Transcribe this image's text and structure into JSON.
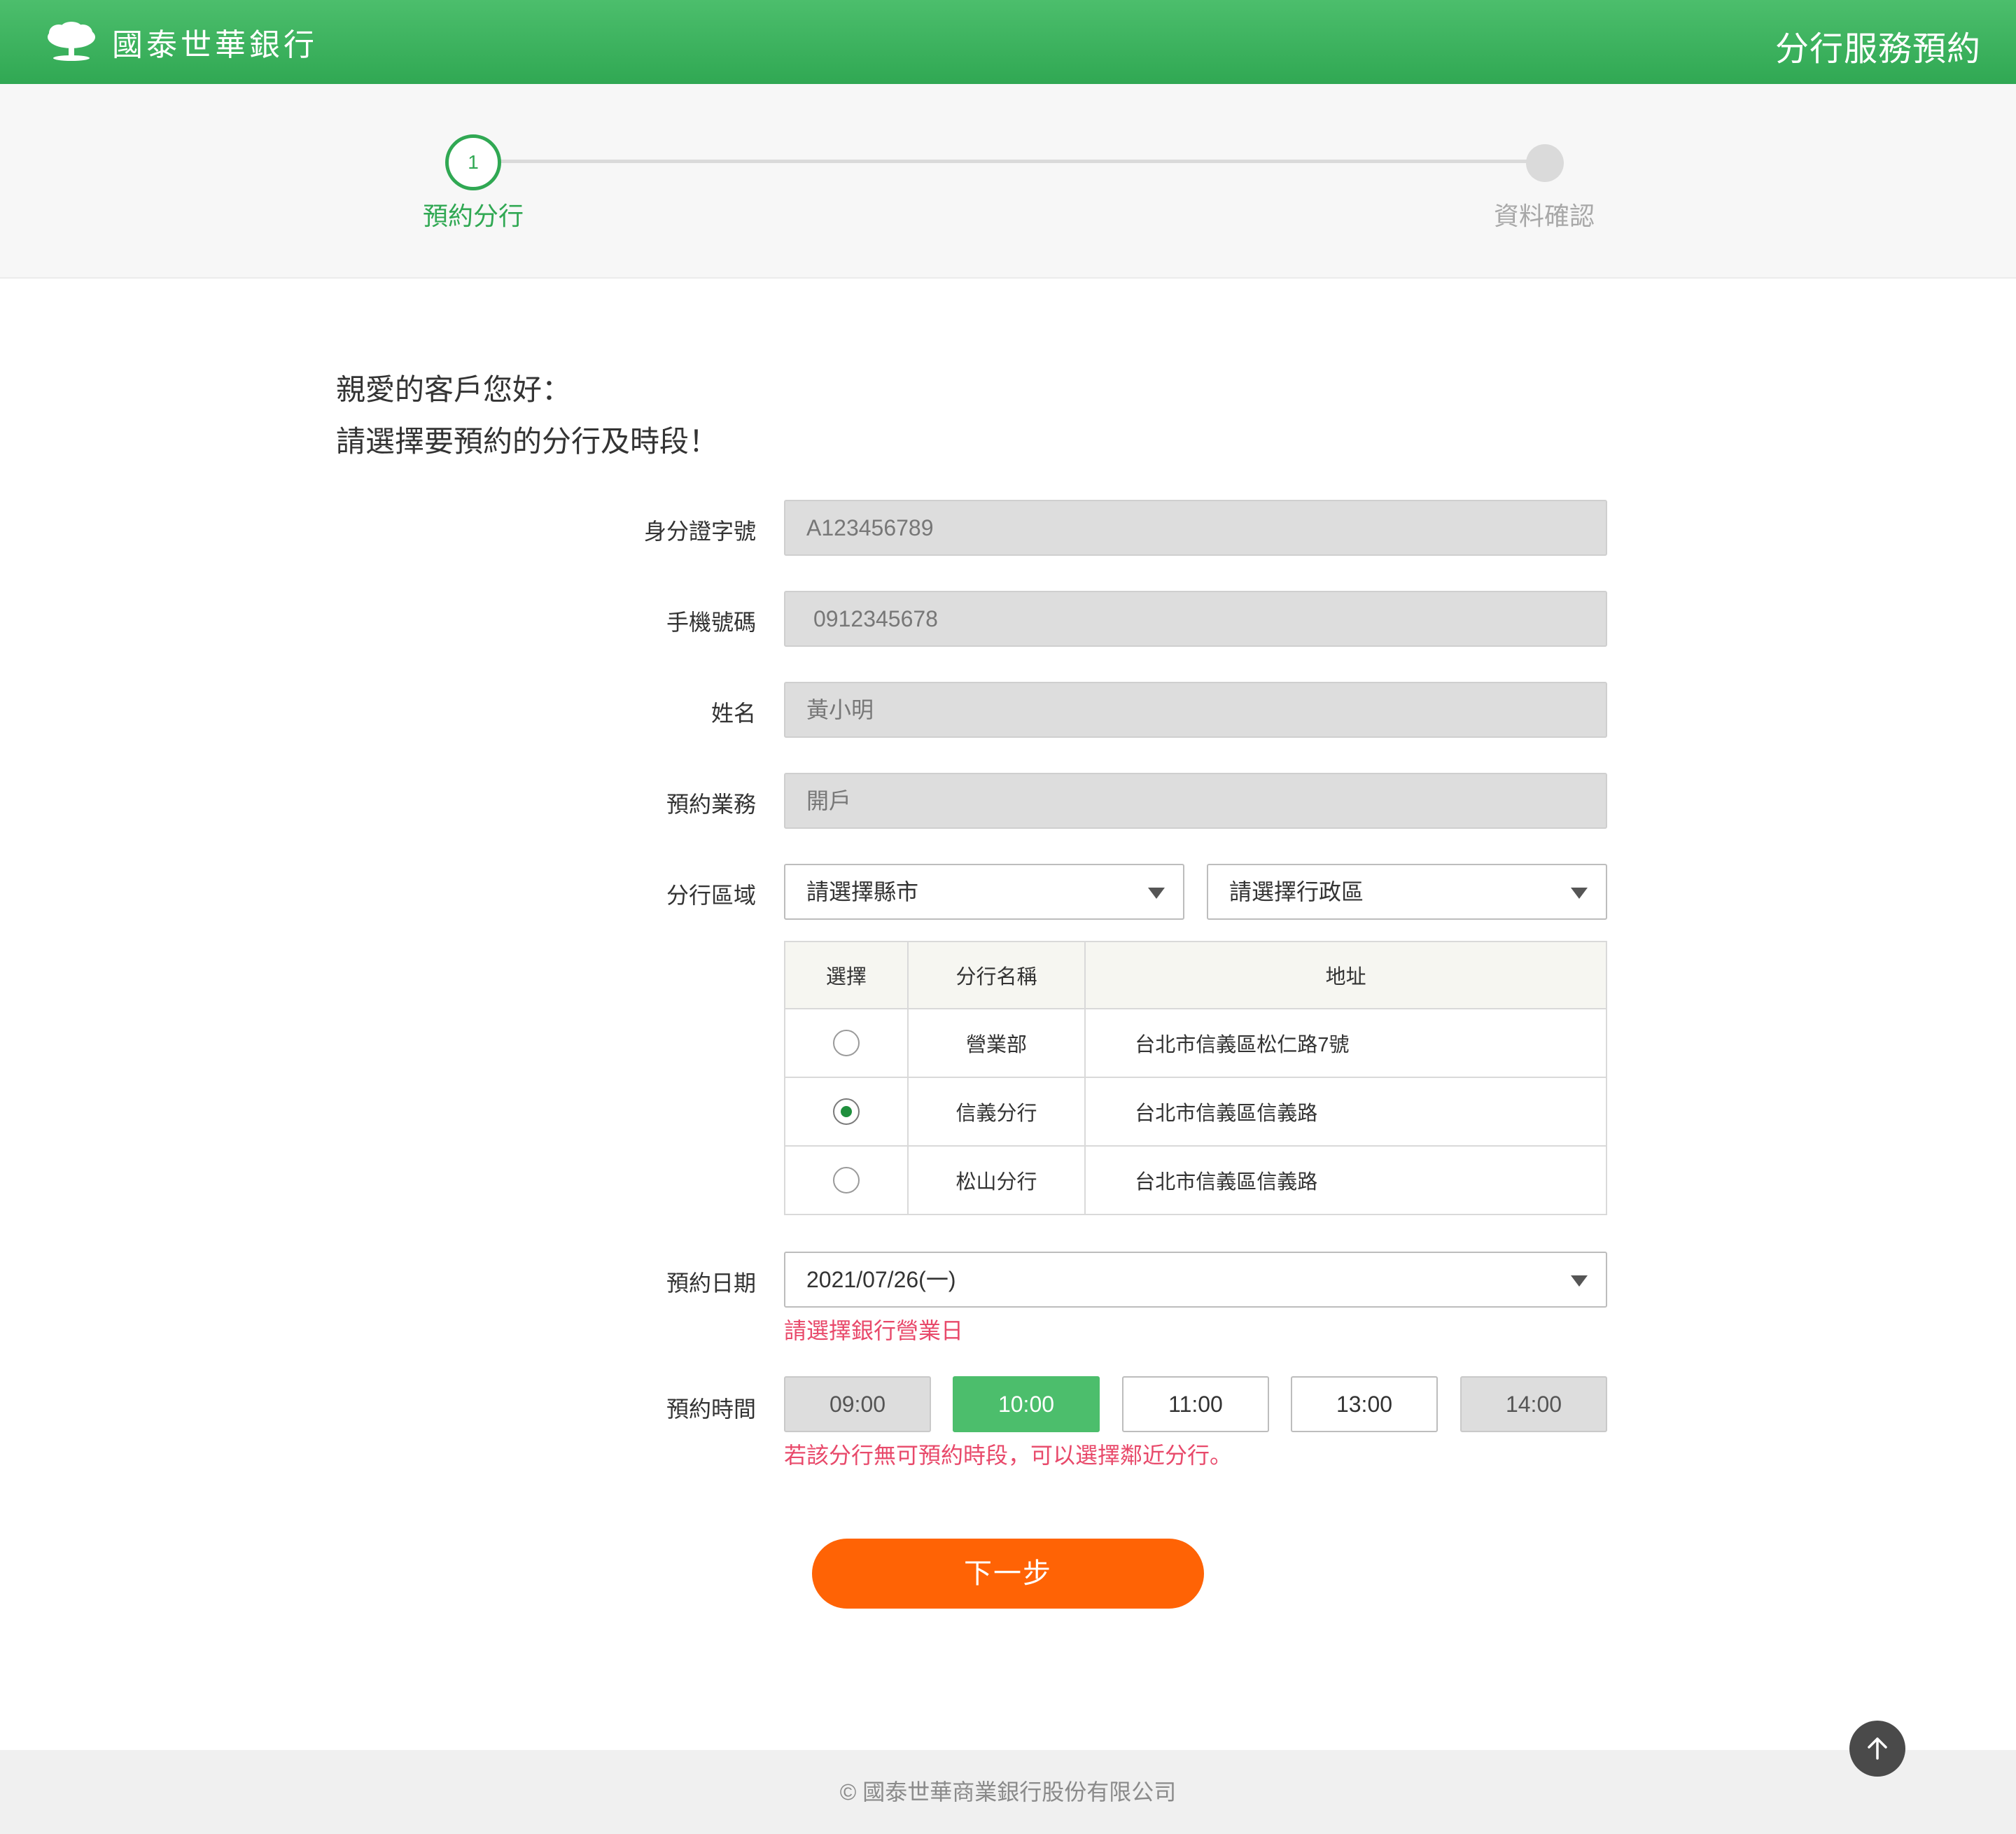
{
  "header": {
    "logo_text": "國泰世華銀行",
    "title": "分行服務預約",
    "logo_icon": "tree-icon"
  },
  "stepper": {
    "step1_number": "1",
    "step1_label": "預約分行",
    "step2_label": "資料確認",
    "active_color": "#30a853"
  },
  "greeting": {
    "line1": "親愛的客戶您好：",
    "line2": "請選擇要預約的分行及時段！"
  },
  "form": {
    "id_label": "身分證字號",
    "id_value": "A123456789",
    "phone_label": "手機號碼",
    "phone_value": "0912345678",
    "name_label": "姓名",
    "name_value": "黃小明",
    "service_label": "預約業務",
    "service_value": "開戶",
    "region_label": "分行區域",
    "city_select": "請選擇縣市",
    "district_select": "請選擇行政區",
    "date_label": "預約日期",
    "date_value": "2021/07/26(一)",
    "date_hint": "請選擇銀行營業日",
    "time_label": "預約時間",
    "time_hint": "若該分行無可預約時段，可以選擇鄰近分行。"
  },
  "branch_table": {
    "headers": [
      "選擇",
      "分行名稱",
      "地址"
    ],
    "rows": [
      {
        "name": "營業部",
        "address": "台北市信義區松仁路7號",
        "selected": false
      },
      {
        "name": "信義分行",
        "address": "台北市信義區信義路",
        "selected": true
      },
      {
        "name": "松山分行",
        "address": "台北市信義區信義路",
        "selected": false
      }
    ]
  },
  "time_slots": [
    {
      "label": "09:00",
      "state": "disabled"
    },
    {
      "label": "10:00",
      "state": "selected"
    },
    {
      "label": "11:00",
      "state": "available"
    },
    {
      "label": "13:00",
      "state": "available"
    },
    {
      "label": "14:00",
      "state": "disabled"
    }
  ],
  "next_button": "下一步",
  "footer": {
    "copyright": "© 國泰世華商業銀行股份有限公司"
  },
  "colors": {
    "brand_green": "#30a853",
    "next_orange": "#ff6305",
    "hint_red": "#e8496a"
  }
}
